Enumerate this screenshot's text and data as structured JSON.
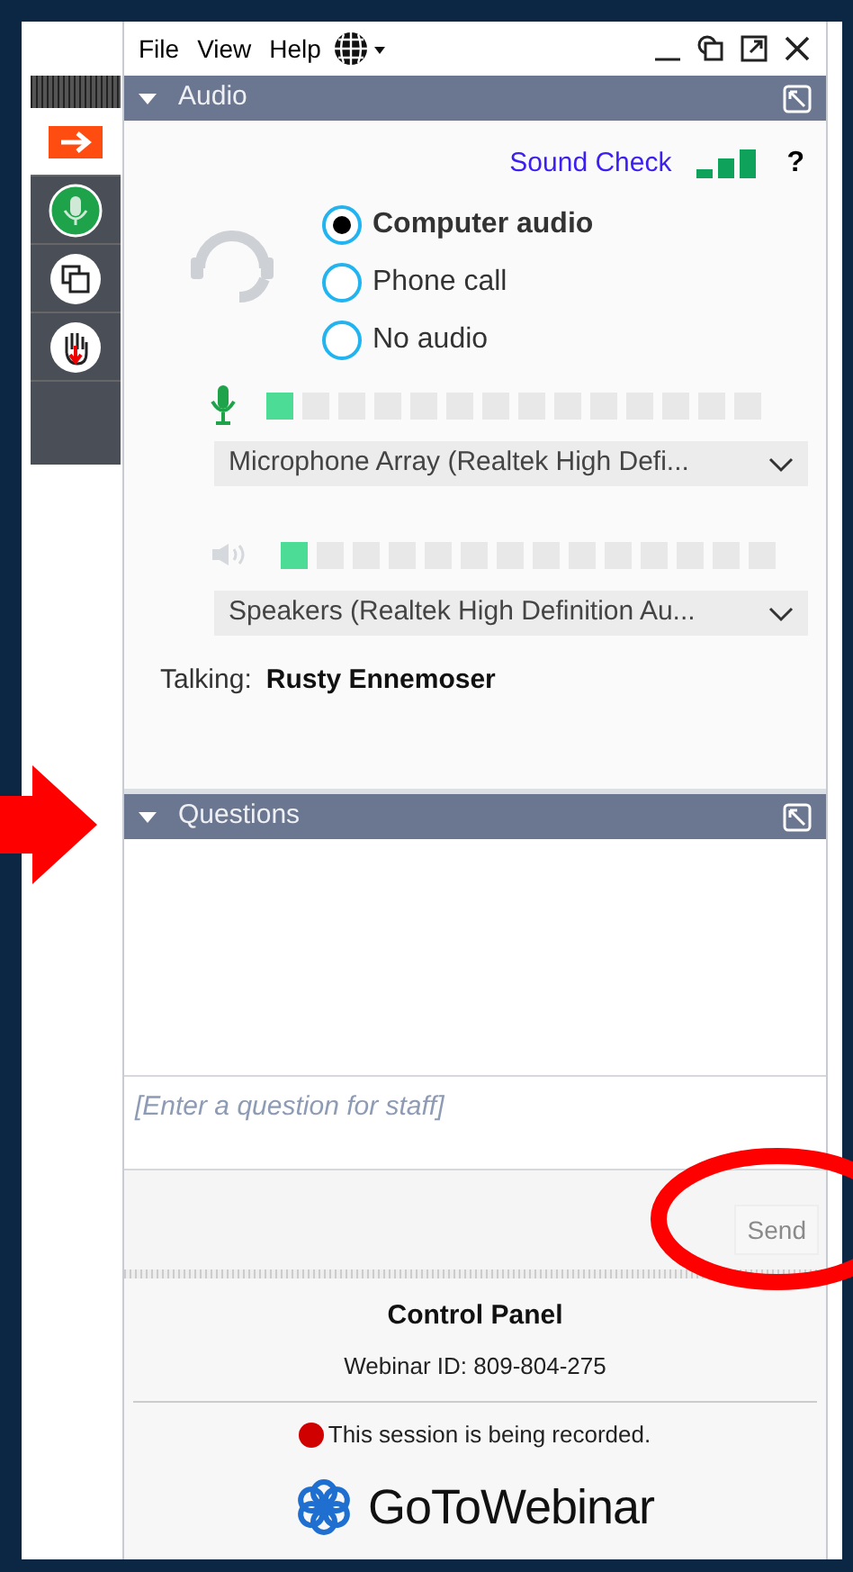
{
  "menu": [
    "File",
    "View",
    "Help"
  ],
  "sidebar": [
    {
      "kind": "arrow",
      "selected": true
    },
    {
      "kind": "mic",
      "selected": false
    },
    {
      "kind": "windows",
      "selected": false
    },
    {
      "kind": "hand",
      "selected": false
    }
  ],
  "audio": {
    "title": "Audio",
    "expanded": true,
    "sound_check": "Sound Check",
    "help": "?",
    "options": [
      {
        "label": "Computer audio",
        "selected": true
      },
      {
        "label": "Phone call",
        "selected": false
      },
      {
        "label": "No audio",
        "selected": false
      }
    ],
    "microphone": {
      "level": 0.07,
      "device": "Microphone Array (Realtek High Defi..."
    },
    "speakers": {
      "level": 0.07,
      "device": "Speakers (Realtek High Definition Au..."
    },
    "talking_label": "Talking:",
    "talking_name": "Rusty Ennemoser"
  },
  "questions": {
    "title": "Questions",
    "expanded": true,
    "placeholder": "[Enter a question for staff]",
    "send": "Send",
    "send_disabled": true
  },
  "footer": {
    "title": "Control Panel",
    "webinar_id": "Webinar ID: 809-804-275",
    "recording": "This session is being recorded.",
    "logo": "**GoTo**Webinar"
  }
}
